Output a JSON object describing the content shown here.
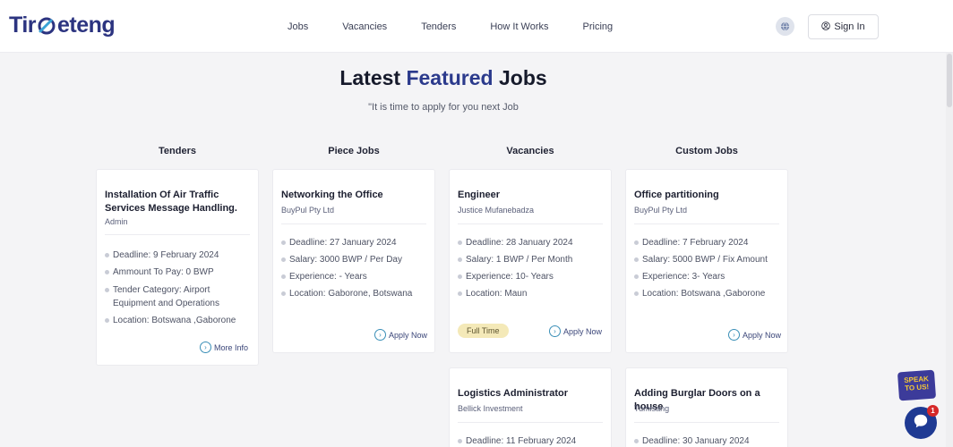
{
  "brand": {
    "logo_left": "Tir",
    "logo_right": "eteng"
  },
  "nav": [
    {
      "label": "Jobs"
    },
    {
      "label": "Vacancies"
    },
    {
      "label": "Tenders"
    },
    {
      "label": "How It Works"
    },
    {
      "label": "Pricing"
    }
  ],
  "header": {
    "language_icon": "globe-icon",
    "signin_label": "Sign In"
  },
  "section": {
    "title_start": "Latest",
    "title_accent": "Featured",
    "title_end": "Jobs",
    "subtitle": "\"It is time to apply for you next Job"
  },
  "columns": [
    {
      "heading": "Tenders"
    },
    {
      "heading": "Piece Jobs"
    },
    {
      "heading": "Vacancies"
    },
    {
      "heading": "Custom Jobs"
    }
  ],
  "cards": {
    "tender": {
      "title": "Installation Of Air Traffic Services Message Handling.",
      "company": "Admin",
      "details": [
        "Deadline: 9 February 2024",
        "Ammount To Pay: 0 BWP",
        "Tender Category: Airport Equipment and Operations",
        "Location: Botswana ,Gaborone"
      ],
      "action": "More Info"
    },
    "piece": {
      "title": "Networking the Office",
      "company": "BuyPul Pty Ltd",
      "details": [
        "Deadline: 27 January 2024",
        "Salary: 3000 BWP / Per Day",
        "Experience: - Years",
        "Location: Gaborone, Botswana"
      ],
      "action": "Apply Now"
    },
    "vacancy": {
      "title": "Engineer",
      "company": "Justice Mufanebadza",
      "details": [
        "Deadline: 28 January 2024",
        "Salary: 1 BWP / Per Month",
        "Experience: 10- Years",
        "Location: Maun"
      ],
      "badge": "Full Time",
      "action": "Apply Now"
    },
    "custom": {
      "title": "Office partitioning",
      "company": "BuyPul Pty Ltd",
      "details": [
        "Deadline: 7 February 2024",
        "Salary: 5000 BWP / Fix Amount",
        "Experience: 3- Years",
        "Location: Botswana ,Gaborone"
      ],
      "action": "Apply Now"
    },
    "vacancy2": {
      "title": "Logistics Administrator",
      "company": "Bellick Investment",
      "details": [
        "Deadline: 11 February 2024"
      ]
    },
    "custom2": {
      "title": "Adding Burglar Doors on a house",
      "company": "Tumisang",
      "details": [
        "Deadline: 30 January 2024"
      ]
    }
  },
  "widgets": {
    "speak_line1": "SPEAK",
    "speak_line2": "TO US!",
    "chat_badge": "1"
  }
}
